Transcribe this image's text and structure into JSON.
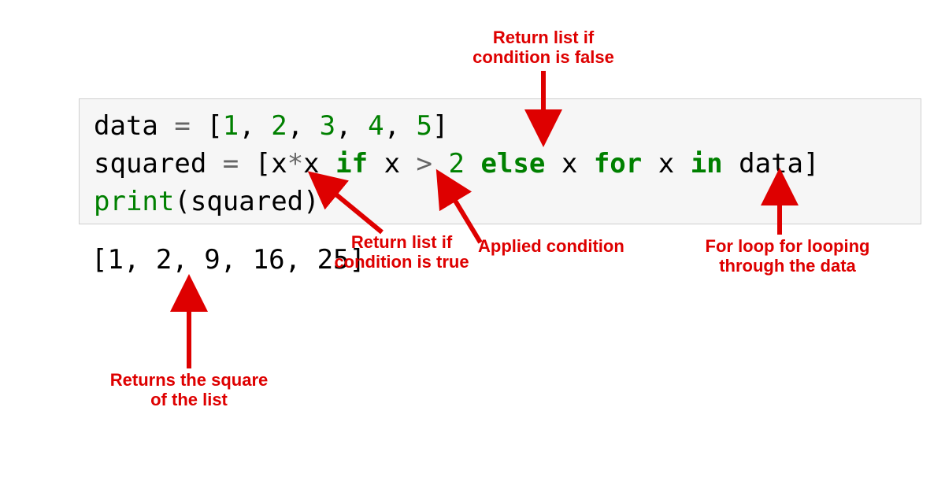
{
  "colors": {
    "annotation": "#de0000",
    "keyword": "#008000",
    "operator": "#666666",
    "number": "#008000",
    "text": "#000000",
    "code_bg": "#f6f6f6",
    "code_border": "#cfcfcf"
  },
  "code": {
    "line1": {
      "data": "data",
      "assign": " = ",
      "lbrack": "[",
      "n1": "1",
      "c1": ", ",
      "n2": "2",
      "c2": ", ",
      "n3": "3",
      "c3": ", ",
      "n4": "4",
      "c4": ", ",
      "n5": "5",
      "rbrack": "]"
    },
    "line2": {
      "squared": "squared",
      "assign": " = ",
      "lbrack": "[",
      "x1": "x",
      "star": "*",
      "x2": "x",
      "sp1": " ",
      "if": "if",
      "sp2": " ",
      "x3": "x",
      "sp3": " ",
      "gt": ">",
      "sp4": " ",
      "two": "2",
      "sp5": " ",
      "else": "else",
      "sp6": " ",
      "x4": "x",
      "sp7": " ",
      "for": "for",
      "sp8": " ",
      "x5": "x",
      "sp9": " ",
      "in": "in",
      "sp10": " ",
      "data": "data",
      "rbrack": "]"
    },
    "line3": {
      "print": "print",
      "lp": "(",
      "arg": "squared",
      "rp": ")"
    }
  },
  "output": "[1, 2, 9, 16, 25]",
  "annotations": {
    "return_false": "Return list if\ncondition is false",
    "return_true": "Return list if\ncondition is true",
    "applied_condition": "Applied condition",
    "for_loop": "For loop for looping\nthrough the data",
    "returns_square": "Returns the square\nof the list"
  }
}
